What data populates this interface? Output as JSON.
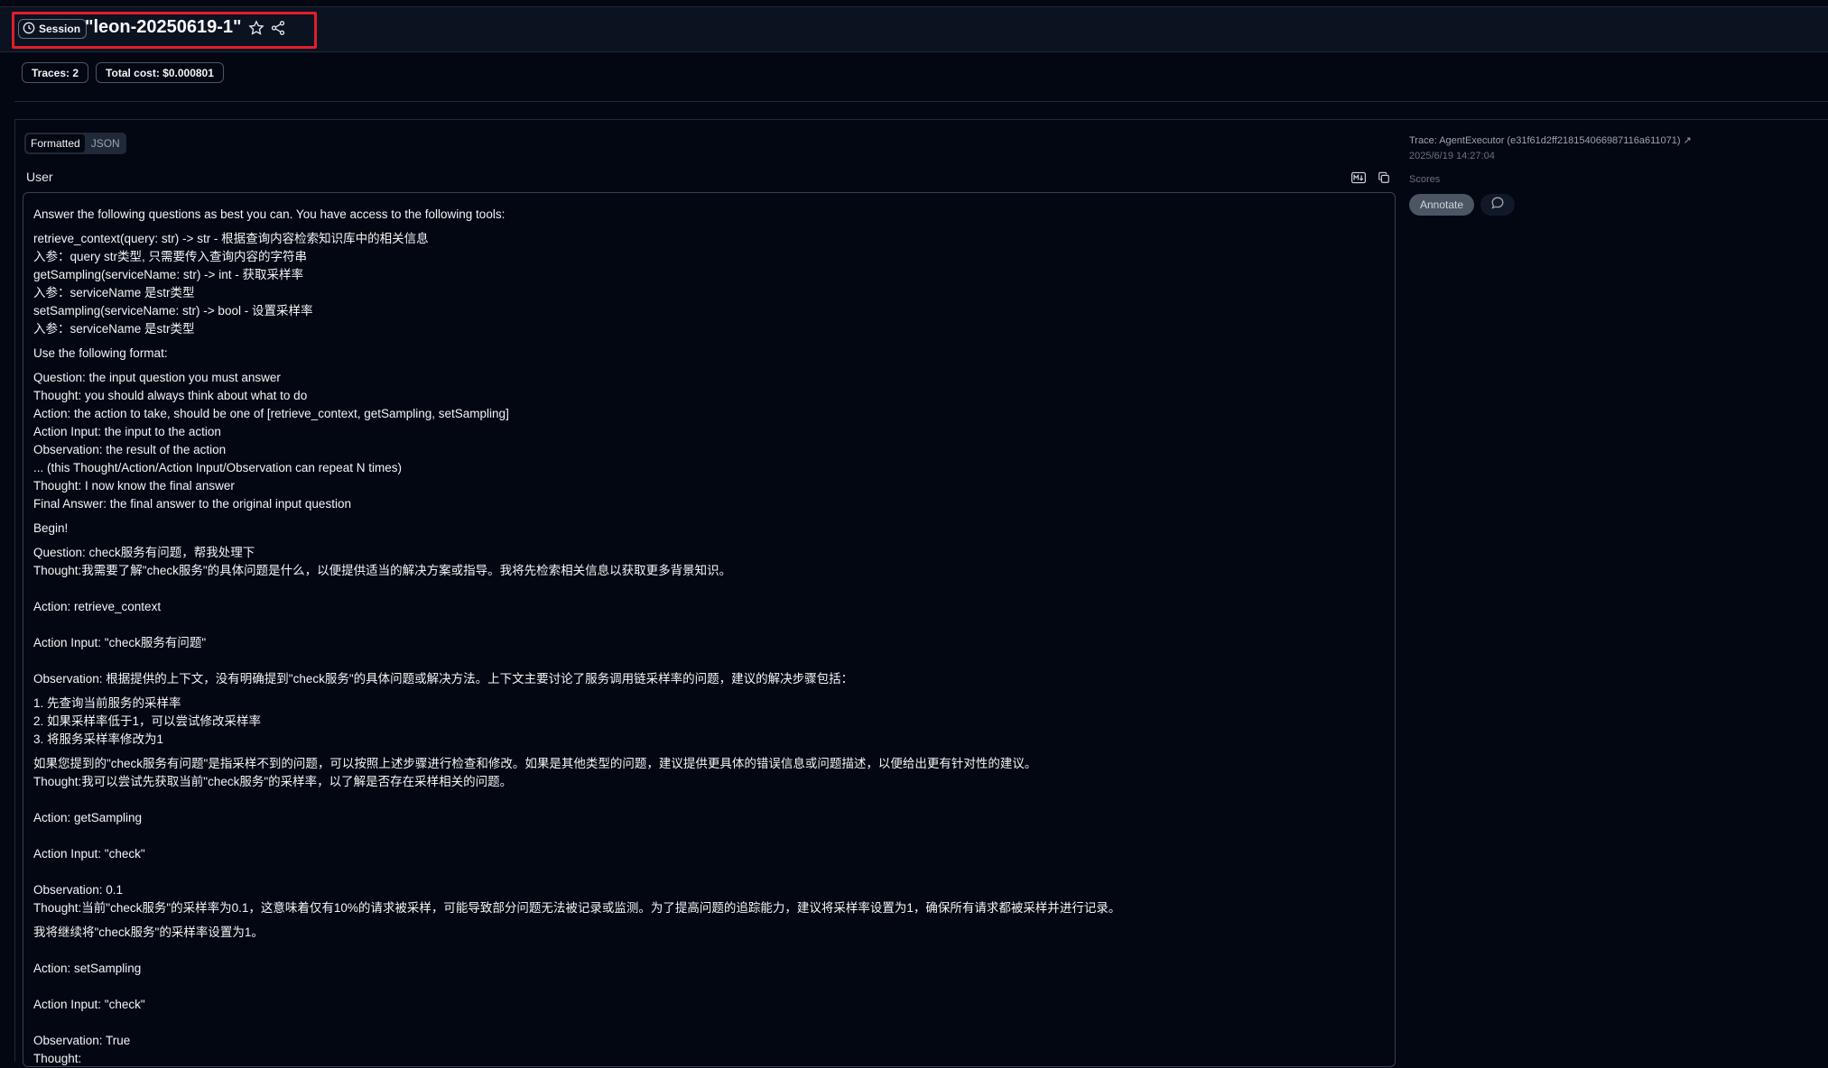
{
  "header": {
    "session_label": "Session",
    "title": "\"leon-20250619-1\""
  },
  "stats": {
    "traces": "Traces: 2",
    "total_cost": "Total cost: $0.000801"
  },
  "view_tabs": [
    "Formatted",
    "JSON"
  ],
  "message": {
    "role": "User",
    "lines": [
      {
        "t": "Answer the following questions as best you can. You have access to the following tools:",
        "after": "s"
      },
      {
        "t": "retrieve_context(query: str) -> str - 根据查询内容检索知识库中的相关信息"
      },
      {
        "t": "入参：query str类型, 只需要传入查询内容的字符串"
      },
      {
        "t": "getSampling(serviceName: str) -> int - 获取采样率"
      },
      {
        "t": "入参：serviceName 是str类型"
      },
      {
        "t": "setSampling(serviceName: str) -> bool - 设置采样率"
      },
      {
        "t": "入参：serviceName 是str类型",
        "after": "s"
      },
      {
        "t": "Use the following format:",
        "after": "s"
      },
      {
        "t": "Question: the input question you must answer"
      },
      {
        "t": "Thought: you should always think about what to do"
      },
      {
        "t": "Action: the action to take, should be one of [retrieve_context, getSampling, setSampling]"
      },
      {
        "t": "Action Input: the input to the action"
      },
      {
        "t": "Observation: the result of the action"
      },
      {
        "t": "... (this Thought/Action/Action Input/Observation can repeat N times)"
      },
      {
        "t": "Thought: I now know the final answer"
      },
      {
        "t": "Final Answer: the final answer to the original input question",
        "after": "s"
      },
      {
        "t": "Begin!",
        "after": "s"
      },
      {
        "t": "Question: check服务有问题，帮我处理下"
      },
      {
        "t": "Thought:我需要了解\"check服务\"的具体问题是什么，以便提供适当的解决方案或指导。我将先检索相关信息以获取更多背景知识。",
        "after": "m"
      },
      {
        "t": "Action: retrieve_context",
        "after": "m"
      },
      {
        "t": "Action Input: \"check服务有问题\"",
        "after": "m"
      },
      {
        "t": "Observation: 根据提供的上下文，没有明确提到\"check服务\"的具体问题或解决方法。上下文主要讨论了服务调用链采样率的问题，建议的解决步骤包括：",
        "after": "s"
      },
      {
        "t": "1. 先查询当前服务的采样率"
      },
      {
        "t": "2. 如果采样率低于1，可以尝试修改采样率"
      },
      {
        "t": "3. 将服务采样率修改为1",
        "after": "s"
      },
      {
        "t": "如果您提到的\"check服务有问题\"是指采样不到的问题，可以按照上述步骤进行检查和修改。如果是其他类型的问题，建议提供更具体的错误信息或问题描述，以便给出更有针对性的建议。"
      },
      {
        "t": "Thought:我可以尝试先获取当前\"check服务\"的采样率，以了解是否存在采样相关的问题。",
        "after": "m"
      },
      {
        "t": "Action: getSampling",
        "after": "m"
      },
      {
        "t": "Action Input: \"check\"",
        "after": "m"
      },
      {
        "t": "Observation: 0.1"
      },
      {
        "t": "Thought:当前\"check服务\"的采样率为0.1，这意味着仅有10%的请求被采样，可能导致部分问题无法被记录或监测。为了提高问题的追踪能力，建议将采样率设置为1，确保所有请求都被采样并进行记录。",
        "after": "s"
      },
      {
        "t": "我将继续将\"check服务\"的采样率设置为1。",
        "after": "m"
      },
      {
        "t": "Action: setSampling",
        "after": "m"
      },
      {
        "t": "Action Input: \"check\"",
        "after": "m"
      },
      {
        "t": "Observation: True"
      },
      {
        "t": "Thought:"
      }
    ]
  },
  "sidebar": {
    "trace_link": "Trace: AgentExecutor (e31f61d2ff218154066987116a611071) ↗",
    "trace_date": "2025/6/19 14:27:04",
    "scores_label": "Scores",
    "annotate_label": "Annotate"
  },
  "icons": [
    "clock-icon",
    "star-icon",
    "share-icon",
    "markdown-icon",
    "copy-icon",
    "comment-icon"
  ]
}
